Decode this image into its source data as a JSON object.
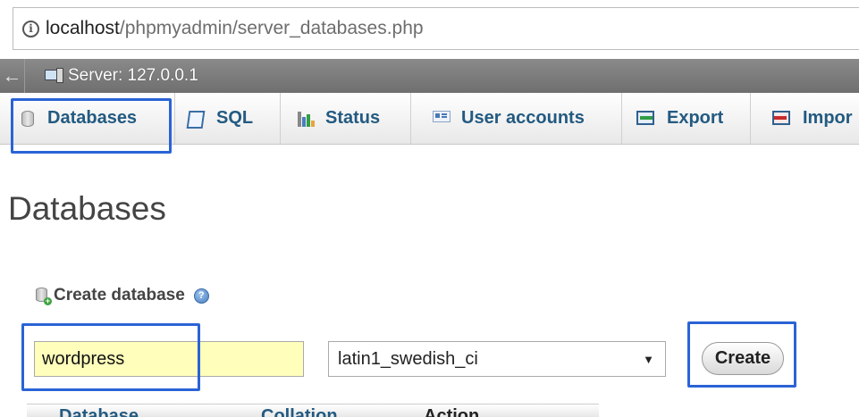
{
  "browser": {
    "url_host": "localhost",
    "url_path": "/phpmyadmin/server_databases.php"
  },
  "server_bar": {
    "label": "Server: 127.0.0.1"
  },
  "tabs": [
    {
      "label": "Databases",
      "icon": "database-icon"
    },
    {
      "label": "SQL",
      "icon": "sql-icon"
    },
    {
      "label": "Status",
      "icon": "status-chart-icon"
    },
    {
      "label": "User accounts",
      "icon": "user-accounts-icon"
    },
    {
      "label": "Export",
      "icon": "export-icon"
    },
    {
      "label": "Impor",
      "icon": "import-icon"
    }
  ],
  "main": {
    "title": "Databases",
    "create_heading": "Create database",
    "db_name_value": "wordpress",
    "collation_value": "latin1_swedish_ci",
    "create_button": "Create"
  },
  "table": {
    "columns": [
      "Database",
      "Collation",
      "Action"
    ]
  },
  "colors": {
    "highlight": "#2a63d6",
    "tab_text": "#235a81",
    "input_bg": "#ffffbb"
  }
}
